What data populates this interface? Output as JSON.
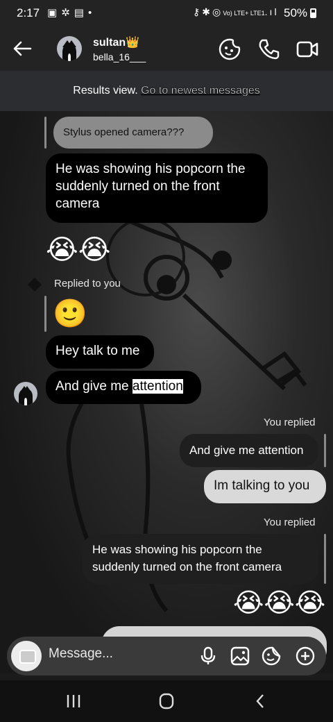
{
  "status_bar": {
    "time": "2:17",
    "left_icons": [
      "image-icon",
      "pinwheel-icon",
      "media-icon",
      "dot-icon"
    ],
    "right_icons": [
      "key-icon",
      "bluetooth-icon",
      "hotspot-icon",
      "volte-lte-icon",
      "signal-icon"
    ],
    "network": "Vo) LTE+ LTE1",
    "battery": "50%"
  },
  "header": {
    "name": "sultan👑",
    "username": "bella_16___",
    "icons": [
      "back-arrow-icon",
      "sticker-face-icon",
      "phone-icon",
      "video-camera-icon"
    ]
  },
  "banner": {
    "text": "Results view.",
    "link": "Go to newest messages"
  },
  "messages": {
    "reply_quote_1": "Stylus opened camera???",
    "msg_1": "He was showing his popcorn the suddenly turned on the front camera",
    "emoji_row_1": "😭😭",
    "replied_to_you": "Replied to you",
    "quoted_emoji": "🙂",
    "msg_2": "Hey talk to me",
    "msg_3_before": "And give me ",
    "msg_3_highlight": "attention",
    "you_replied_1": "You replied",
    "sent_quote_1": "And give me attention",
    "sent_1": "Im talking to you",
    "you_replied_2": "You replied",
    "sent_quote_2": "He was showing his popcorn the suddenly turned on the front camera",
    "emoji_row_2": "😭😭😭"
  },
  "composer": {
    "placeholder": "Message...",
    "icons": [
      "camera-icon",
      "microphone-icon",
      "gallery-icon",
      "sticker-icon",
      "add-icon"
    ]
  },
  "nav": {
    "icons": [
      "recents-icon",
      "home-icon",
      "back-icon"
    ]
  }
}
